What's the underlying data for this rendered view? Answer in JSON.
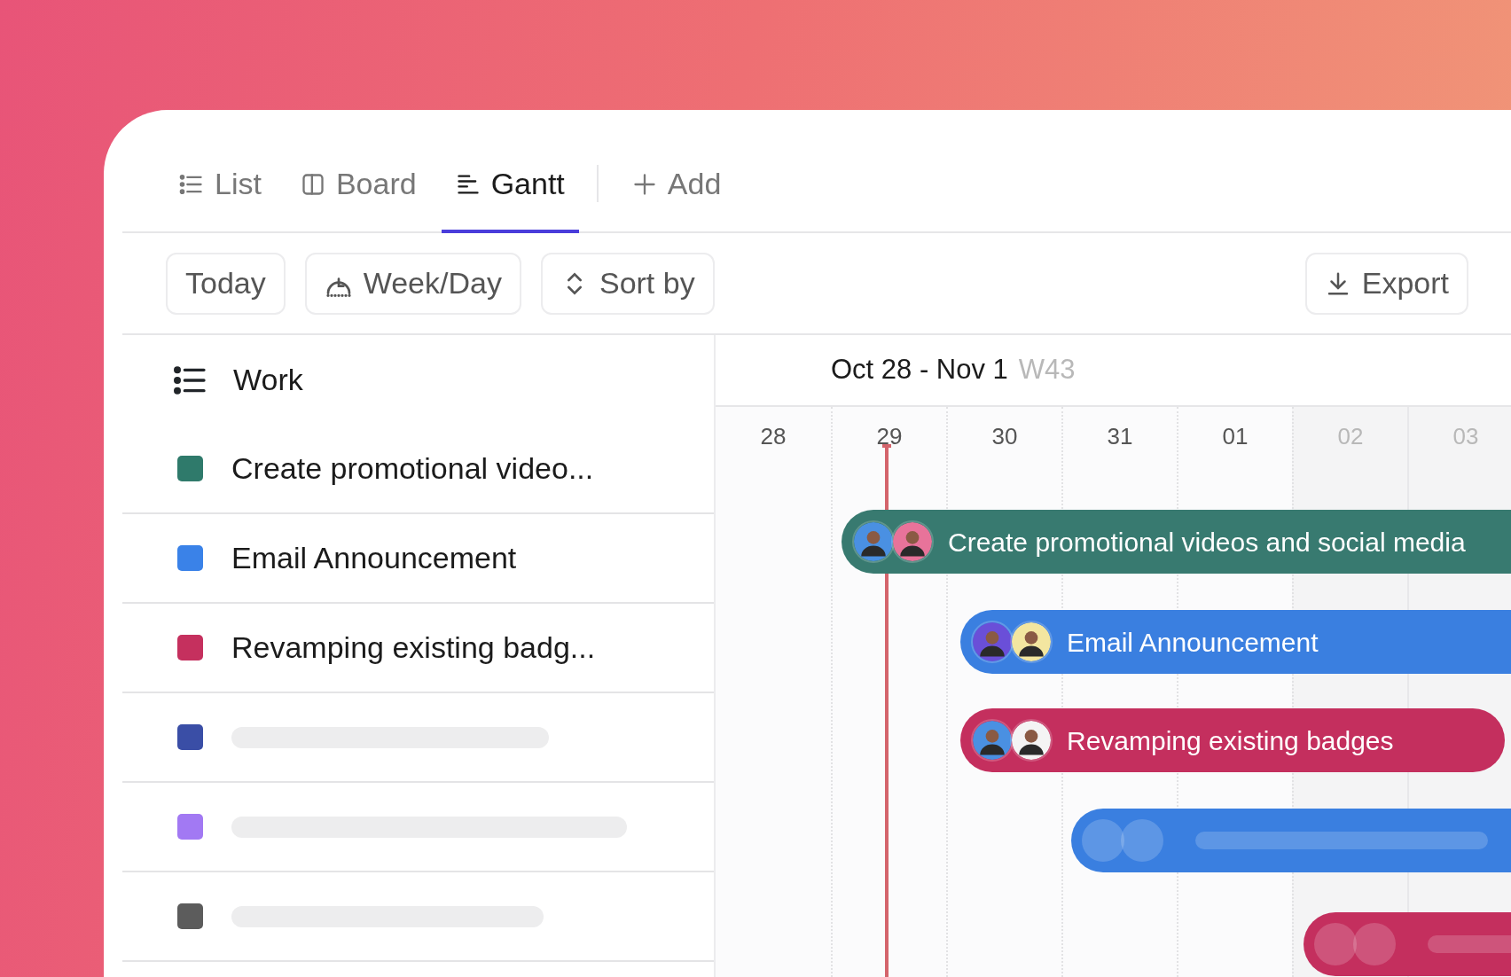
{
  "tabs": [
    {
      "label": "List",
      "kind": "list",
      "selected": false
    },
    {
      "label": "Board",
      "kind": "board",
      "selected": false
    },
    {
      "label": "Gantt",
      "kind": "gantt",
      "selected": true
    }
  ],
  "add_tab": {
    "label": "Add"
  },
  "toolbar": {
    "buttons": [
      {
        "label": "Today",
        "kind": "plain"
      },
      {
        "label": "Week/Day",
        "kind": "scale"
      },
      {
        "label": "Sort by",
        "kind": "sort"
      }
    ],
    "export": {
      "label": "Export"
    }
  },
  "list": {
    "title": "Work",
    "rows": [
      {
        "kind": "task",
        "label": "Create promotional video...",
        "color": "#2f7a6b"
      },
      {
        "kind": "task",
        "label": "Email Announcement",
        "color": "#3a82e8"
      },
      {
        "kind": "task",
        "label": "Revamping existing badg...",
        "color": "#c5305e"
      },
      {
        "kind": "placeholder",
        "color": "#3a4ea6"
      },
      {
        "kind": "placeholder",
        "color": "#a279f3"
      },
      {
        "kind": "placeholder",
        "color": "#5c5c5c"
      }
    ]
  },
  "timeline": {
    "range": "Oct 28 - Nov 1",
    "week": "W43",
    "days": [
      {
        "label": "28",
        "weekend": false,
        "today": false
      },
      {
        "label": "29",
        "weekend": false,
        "today": true
      },
      {
        "label": "30",
        "weekend": false,
        "today": false
      },
      {
        "label": "31",
        "weekend": false,
        "today": false
      },
      {
        "label": "01",
        "weekend": false,
        "today": false
      },
      {
        "label": "02",
        "weekend": true,
        "today": false
      },
      {
        "label": "03",
        "weekend": true,
        "today": false
      }
    ],
    "bars": [
      {
        "kind": "task",
        "label": "Create promotional videos and social media",
        "color": "#387a70"
      },
      {
        "kind": "task",
        "label": "Email Announcement",
        "color": "#3a7fe0"
      },
      {
        "kind": "task",
        "label": "Revamping existing badges",
        "color": "#c42f5e"
      },
      {
        "kind": "placeholder",
        "color": "#3a7fe0"
      },
      {
        "kind": "placeholder",
        "color": "#c42f5e"
      }
    ]
  }
}
